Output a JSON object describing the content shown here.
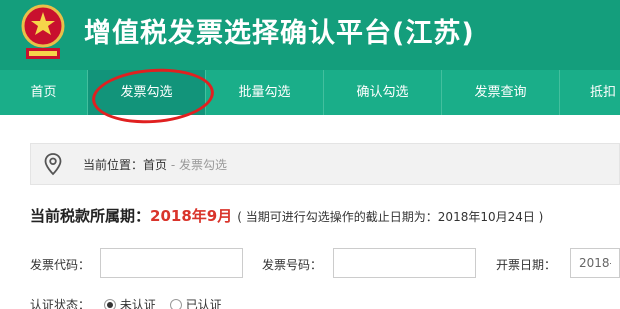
{
  "header": {
    "title": "增值税发票选择确认平台(江苏)",
    "logo_icon": "tax-emblem-icon",
    "accent_color": "#149e7c"
  },
  "nav": {
    "items": [
      {
        "label": "首页"
      },
      {
        "label": "发票勾选"
      },
      {
        "label": "批量勾选"
      },
      {
        "label": "确认勾选"
      },
      {
        "label": "发票查询"
      },
      {
        "label": "抵扣"
      }
    ],
    "active_index": 1
  },
  "breadcrumb": {
    "icon": "location-pin-icon",
    "prefix": "当前位置：",
    "home": "首页",
    "separator": " - ",
    "current": "发票勾选"
  },
  "period": {
    "label": "当前税款所属期：",
    "value": "2018年9月",
    "note": "( 当期可进行勾选操作的截止日期为：2018年10月24日 )"
  },
  "form": {
    "invoice_code_label": "发票代码：",
    "invoice_code_value": "",
    "invoice_number_label": "发票号码：",
    "invoice_number_value": "",
    "date_label": "开票日期：",
    "date_value": "2018-",
    "status_label": "认证状态：",
    "status_options": [
      "未认证",
      "已认证"
    ],
    "status_selected": "未认证"
  }
}
